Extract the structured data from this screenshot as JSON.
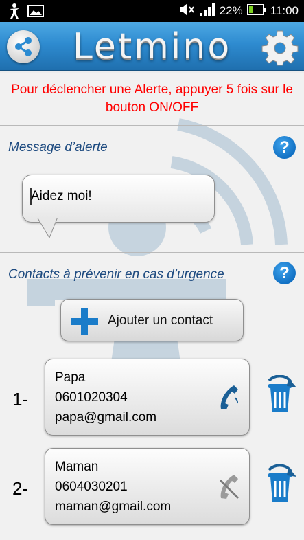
{
  "status_bar": {
    "battery": "22%",
    "time": "11:00",
    "icons": [
      "accessibility-icon",
      "image-icon",
      "mute-icon",
      "signal-icon",
      "battery-icon"
    ]
  },
  "header": {
    "title": "Letmino",
    "share_icon": "share-icon",
    "settings_icon": "gear-icon"
  },
  "instruction": "Pour déclencher une Alerte, appuyer 5 fois sur le bouton ON/OFF",
  "message_section": {
    "title": "Message d’alerte",
    "help": "?",
    "message": "Aidez moi!"
  },
  "contacts_section": {
    "title": "Contacts à prévenir en cas d’urgence",
    "help": "?",
    "add_label": "Ajouter un contact",
    "contacts": [
      {
        "index": "1-",
        "name": "Papa",
        "phone": "0601020304",
        "email": "papa@gmail.com",
        "call_enabled": true
      },
      {
        "index": "2-",
        "name": "Maman",
        "phone": "0604030201",
        "email": "maman@gmail.com",
        "call_enabled": false
      }
    ]
  },
  "colors": {
    "header_blue": "#2e8bd0",
    "alert_red": "#ff0000",
    "section_title": "#1e4b80",
    "icon_blue": "#1a7cc9"
  }
}
